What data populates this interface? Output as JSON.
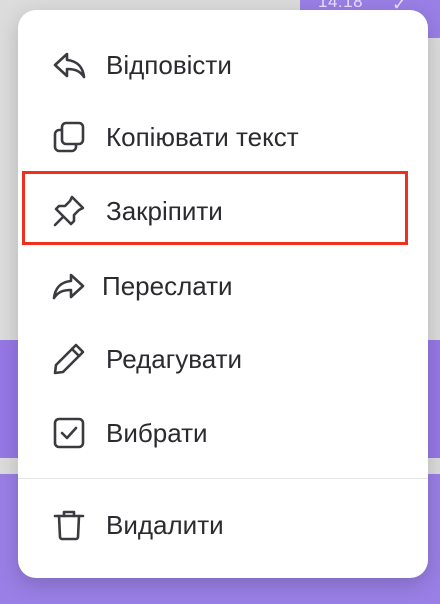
{
  "status": {
    "time": "14:18"
  },
  "menu": {
    "items": [
      {
        "label": "Відповісти",
        "icon": "reply-icon"
      },
      {
        "label": "Копіювати текст",
        "icon": "copy-icon"
      },
      {
        "label": "Закріпити",
        "icon": "pin-icon"
      },
      {
        "label": "Переслати",
        "icon": "forward-icon"
      },
      {
        "label": "Редагувати",
        "icon": "pencil-icon"
      },
      {
        "label": "Вибрати",
        "icon": "checkbox-icon"
      },
      {
        "label": "Видалити",
        "icon": "trash-icon"
      }
    ],
    "highlighted": "Закріпити"
  },
  "colors": {
    "accent": "#9a7fe6",
    "highlight_border": "#f0301f",
    "text": "#2b2b2f"
  }
}
